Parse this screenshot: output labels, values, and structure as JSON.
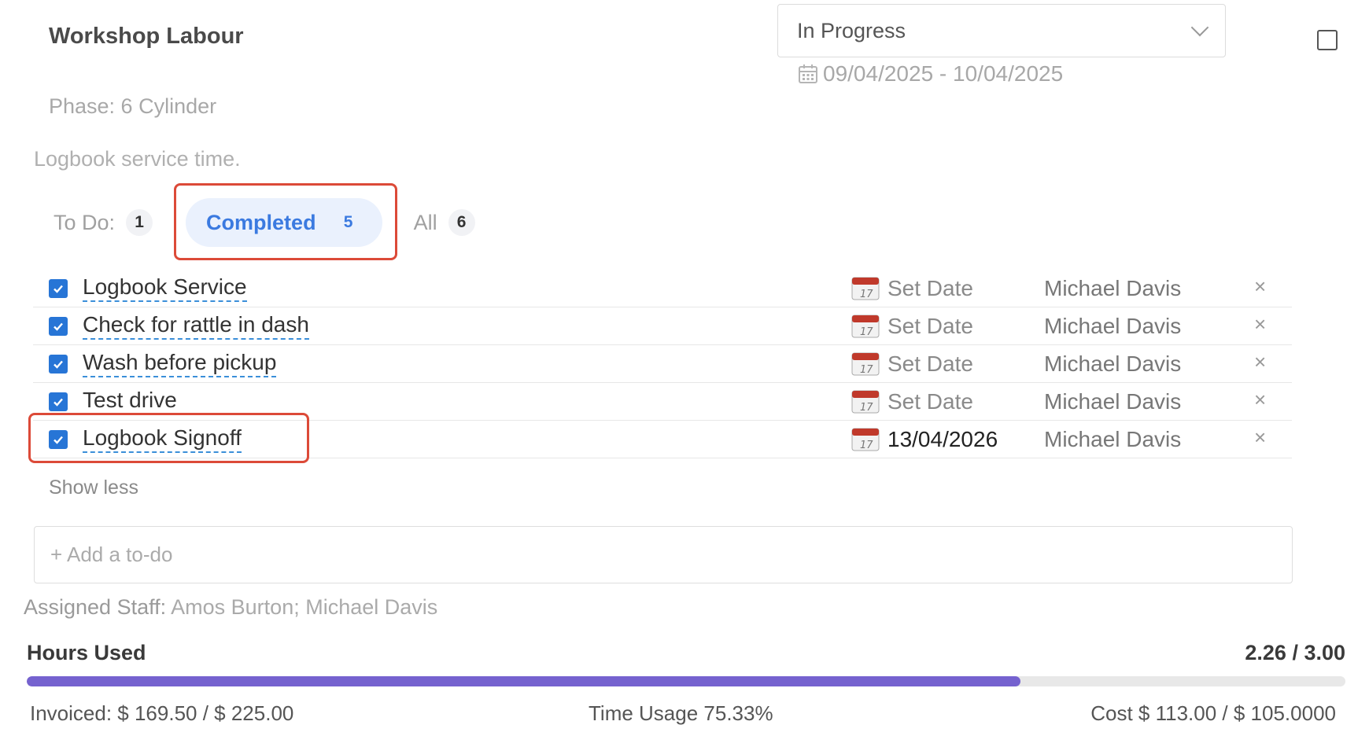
{
  "header": {
    "title": "Workshop Labour",
    "status": "In Progress",
    "date_range": "09/04/2025 - 10/04/2025",
    "phase": "Phase: 6 Cylinder",
    "description": "Logbook service time."
  },
  "tabs": [
    {
      "label": "To Do:",
      "count": "1"
    },
    {
      "label": "Completed",
      "count": "5"
    },
    {
      "label": "All",
      "count": "6"
    }
  ],
  "todos": [
    {
      "label": "Logbook Service",
      "due": "Set Date",
      "assignee": "Michael Davis",
      "remove": "×"
    },
    {
      "label": "Check for rattle in dash",
      "due": "Set Date",
      "assignee": "Michael Davis",
      "remove": "×"
    },
    {
      "label": "Wash before pickup",
      "due": "Set Date",
      "assignee": "Michael Davis",
      "remove": "×"
    },
    {
      "label": "Test drive",
      "due": "Set Date",
      "assignee": "Michael Davis",
      "remove": "×"
    },
    {
      "label": "Logbook Signoff",
      "due": "13/04/2026",
      "assignee": "Michael Davis",
      "remove": "×"
    }
  ],
  "show_less": "Show less",
  "add_todo_placeholder": "+ Add a to-do",
  "staff": {
    "label": "Assigned Staff:",
    "names": "Amos Burton; Michael Davis"
  },
  "hours": {
    "label": "Hours Used",
    "value": "2.26 / 3.00",
    "used_fraction": 0.7533,
    "invoiced": "Invoiced: $ 169.50 / $ 225.00",
    "time_usage": "Time Usage 75.33%",
    "cost": "Cost $ 113.00 / $ 105.0000"
  },
  "colors": {
    "accent": "#3b7ae0",
    "checkbox": "#2775d6",
    "progress": "#7562cf",
    "highlight": "#dc4a38"
  }
}
